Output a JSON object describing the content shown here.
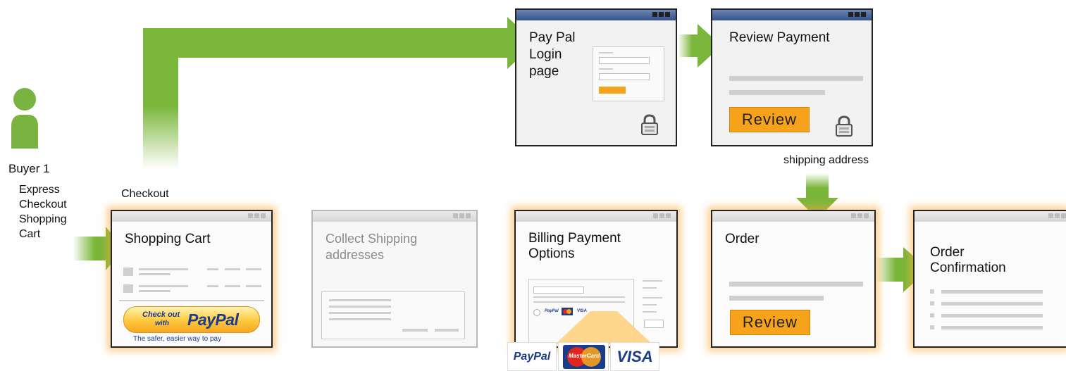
{
  "buyer": {
    "name": "Buyer 1",
    "flow_label": "Express Checkout Shopping Cart"
  },
  "checkout_label": "Checkout",
  "shipping_label": "shipping address",
  "windows": {
    "shopping_cart": {
      "title": "Shopping Cart"
    },
    "collect_shipping": {
      "title": "Collect Shipping addresses"
    },
    "billing": {
      "title": "Billing Payment Options"
    },
    "order": {
      "title": "Order",
      "button": "Review"
    },
    "order_confirmation": {
      "title": "Order Confirmation"
    },
    "paypal_login": {
      "title": "Pay Pal Login page"
    },
    "review_payment": {
      "title": "Review Payment",
      "button": "Review"
    }
  },
  "paypal_button": {
    "checkout_text": "Check out",
    "with_text": "with",
    "brand": "PayPal",
    "tagline": "The safer, easier way to pay"
  },
  "payment_logos": {
    "paypal": "PayPal",
    "mastercard": "MasterCard",
    "visa": "VISA"
  },
  "mini_logos": {
    "paypal": "PayPal",
    "visa": "VISA"
  },
  "colors": {
    "arrow_green": "#7ab63a",
    "review_orange": "#f7a21b",
    "titlebar_blue": "#34528a",
    "person_green": "#79b440",
    "glow": "#ffb347"
  }
}
